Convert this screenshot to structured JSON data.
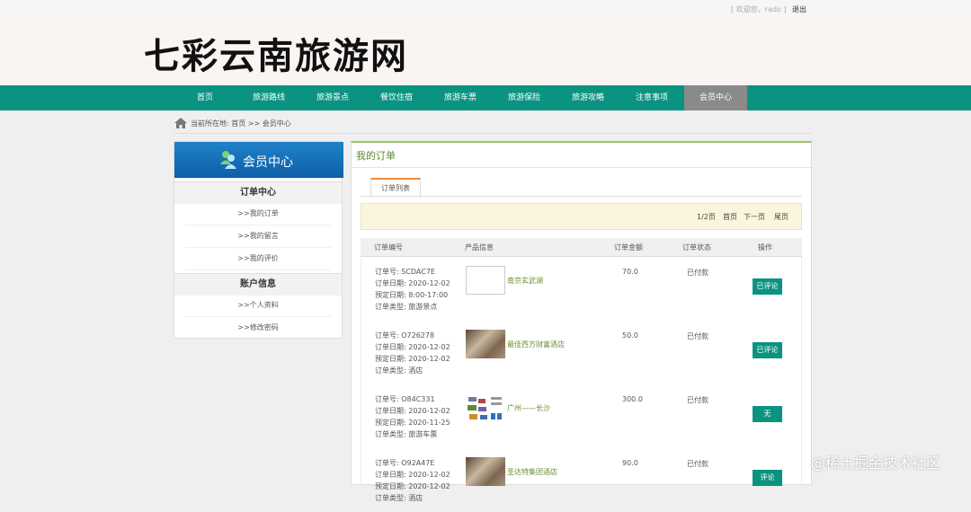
{
  "top": {
    "welcome": "[ 欢迎您，rado ]",
    "logout": "退出"
  },
  "header": {
    "logo": "七彩云南旅游网"
  },
  "nav": [
    "首页",
    "旅游路线",
    "旅游景点",
    "餐饮住宿",
    "旅游车票",
    "旅游保险",
    "旅游攻略",
    "注意事项",
    "会员中心"
  ],
  "breadcrumb": {
    "text": "当前所在地:  首页 >> 会员中心"
  },
  "sidebar": {
    "title": "会员中心",
    "section1": "订单中心",
    "links1": [
      ">>我的订单",
      ">>我的留言",
      ">>我的评价"
    ],
    "section2": "账户信息",
    "links2": [
      ">>个人资料",
      ">>修改密码"
    ]
  },
  "main": {
    "title": "我的订单",
    "tab": "订单列表",
    "pager": {
      "pages": "1/2页",
      "first": "首页",
      "next": "下一页",
      "last": "尾页"
    },
    "headers": [
      "订单编号",
      "产品信息",
      "订单金额",
      "订单状态",
      "操作"
    ],
    "orders": [
      {
        "no": "订单号:  SCDAC7E",
        "date": "订单日期:  2020-12-02",
        "reserve": "预定日期:  8:00-17:00",
        "type": "订单类型:  旅游景点",
        "product": "南京玄武湖",
        "amount": "70.0",
        "status": "已付款",
        "action": "已评论"
      },
      {
        "no": "订单号:  O726278",
        "date": "订单日期:  2020-12-02",
        "reserve": "预定日期:  2020-12-02",
        "type": "订单类型:  酒店",
        "product": "最佳西方财富酒店",
        "amount": "50.0",
        "status": "已付款",
        "action": "已评论"
      },
      {
        "no": "订单号:  O84C331",
        "date": "订单日期:  2020-12-02",
        "reserve": "预定日期:  2020-11-25",
        "type": "订单类型:  旅游车票",
        "product": "广州——长沙",
        "amount": "300.0",
        "status": "已付款",
        "action": "无"
      },
      {
        "no": "订单号:  O92A47E",
        "date": "订单日期:  2020-12-02",
        "reserve": "预定日期:  2020-12-02",
        "type": "订单类型:  酒店",
        "product": "圣达特集团酒店",
        "amount": "90.0",
        "status": "已付款",
        "action": "评论"
      }
    ]
  },
  "watermark": "@稀土掘金技术社区"
}
